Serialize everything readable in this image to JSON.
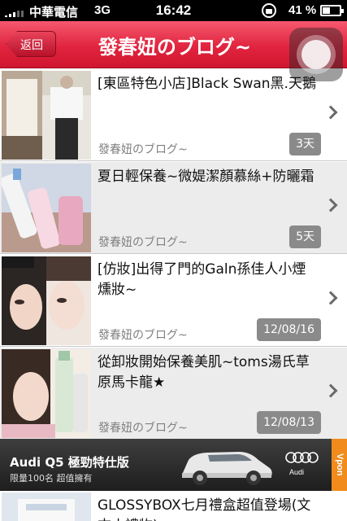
{
  "status_bar": {
    "carrier": "中華電信",
    "network": "3G",
    "time": "16:42",
    "battery_percent": "41 %"
  },
  "nav": {
    "back_label": "返回",
    "title": "發春妞のブログ~"
  },
  "posts": [
    {
      "title": "[東區特色小店]Black Swan黑.天鵝",
      "author": "發春妞のブログ~",
      "date": "3天",
      "thumb": "storefront-photo"
    },
    {
      "title": "夏日輕保養~微媞潔顏慕絲+防曬霜",
      "author": "發春妞のブログ~",
      "date": "5天",
      "thumb": "skincare-bottles-photo"
    },
    {
      "title": "[仿妝]出得了門的Galn孫佳人小煙燻妝~",
      "author": "發春妞のブログ~",
      "date": "12/08/16",
      "thumb": "makeup-face-photo"
    },
    {
      "title": "從卸妝開始保養美肌~toms湯氏草原馬卡龍★",
      "author": "發春妞のブログ~",
      "date": "12/08/13",
      "thumb": "selfie-with-bottle-photo"
    },
    {
      "title": "GLOSSYBOX七月禮盒超值登場(文末小禮物)❤",
      "author": "",
      "date": "",
      "thumb": "glossybox-photo"
    }
  ],
  "ad": {
    "title": "Audi Q5  極勁特仕版",
    "subtitle": "限量100名  超值擁有",
    "brand": "Audi",
    "tag": "Vpon"
  },
  "colors": {
    "nav_red": "#e1243f",
    "date_badge": "#8a8a8a",
    "ad_tag": "#f08b1c"
  }
}
